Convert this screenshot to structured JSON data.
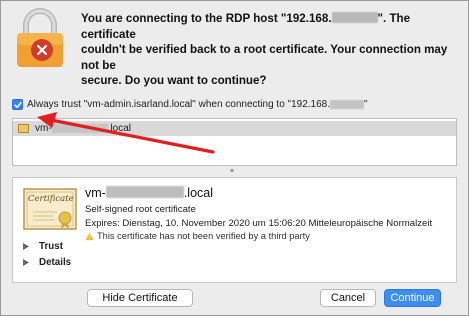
{
  "message": {
    "line1_a": "You are connecting to the RDP host \"192.168.",
    "line1_b": "\". The certificate",
    "line2": "couldn't be verified back to a root certificate. Your connection may not be",
    "line3": "secure. Do you want to continue?"
  },
  "trust": {
    "checked": true,
    "label_a": "Always trust \"vm-admin.isarland.local\" when connecting to \"192.168.",
    "label_b": "\""
  },
  "cert_list": {
    "item_prefix": "vm-",
    "item_suffix": ".local"
  },
  "detail": {
    "name_prefix": "vm-",
    "name_suffix": ".local",
    "subtitle": "Self-signed root certificate",
    "expires": "Expires: Dienstag, 10. November 2020 um 15:06:20 Mitteleuropäische Normalzeit",
    "warning": "This certificate has not been verified by a third party",
    "sections": [
      "Trust",
      "Details"
    ],
    "cert_icon_text": "Certificate"
  },
  "buttons": {
    "hide": "Hide Certificate",
    "cancel": "Cancel",
    "continue": "Continue"
  },
  "colors": {
    "accent": "#3d8ef0",
    "annotation_arrow": "#e02020",
    "lock_body": "#f0a030"
  },
  "icons": [
    "lock-icon",
    "remote-desktop-icon",
    "checkmark-icon",
    "certificate-icon",
    "warning-icon",
    "disclosure-triangle-icon"
  ]
}
